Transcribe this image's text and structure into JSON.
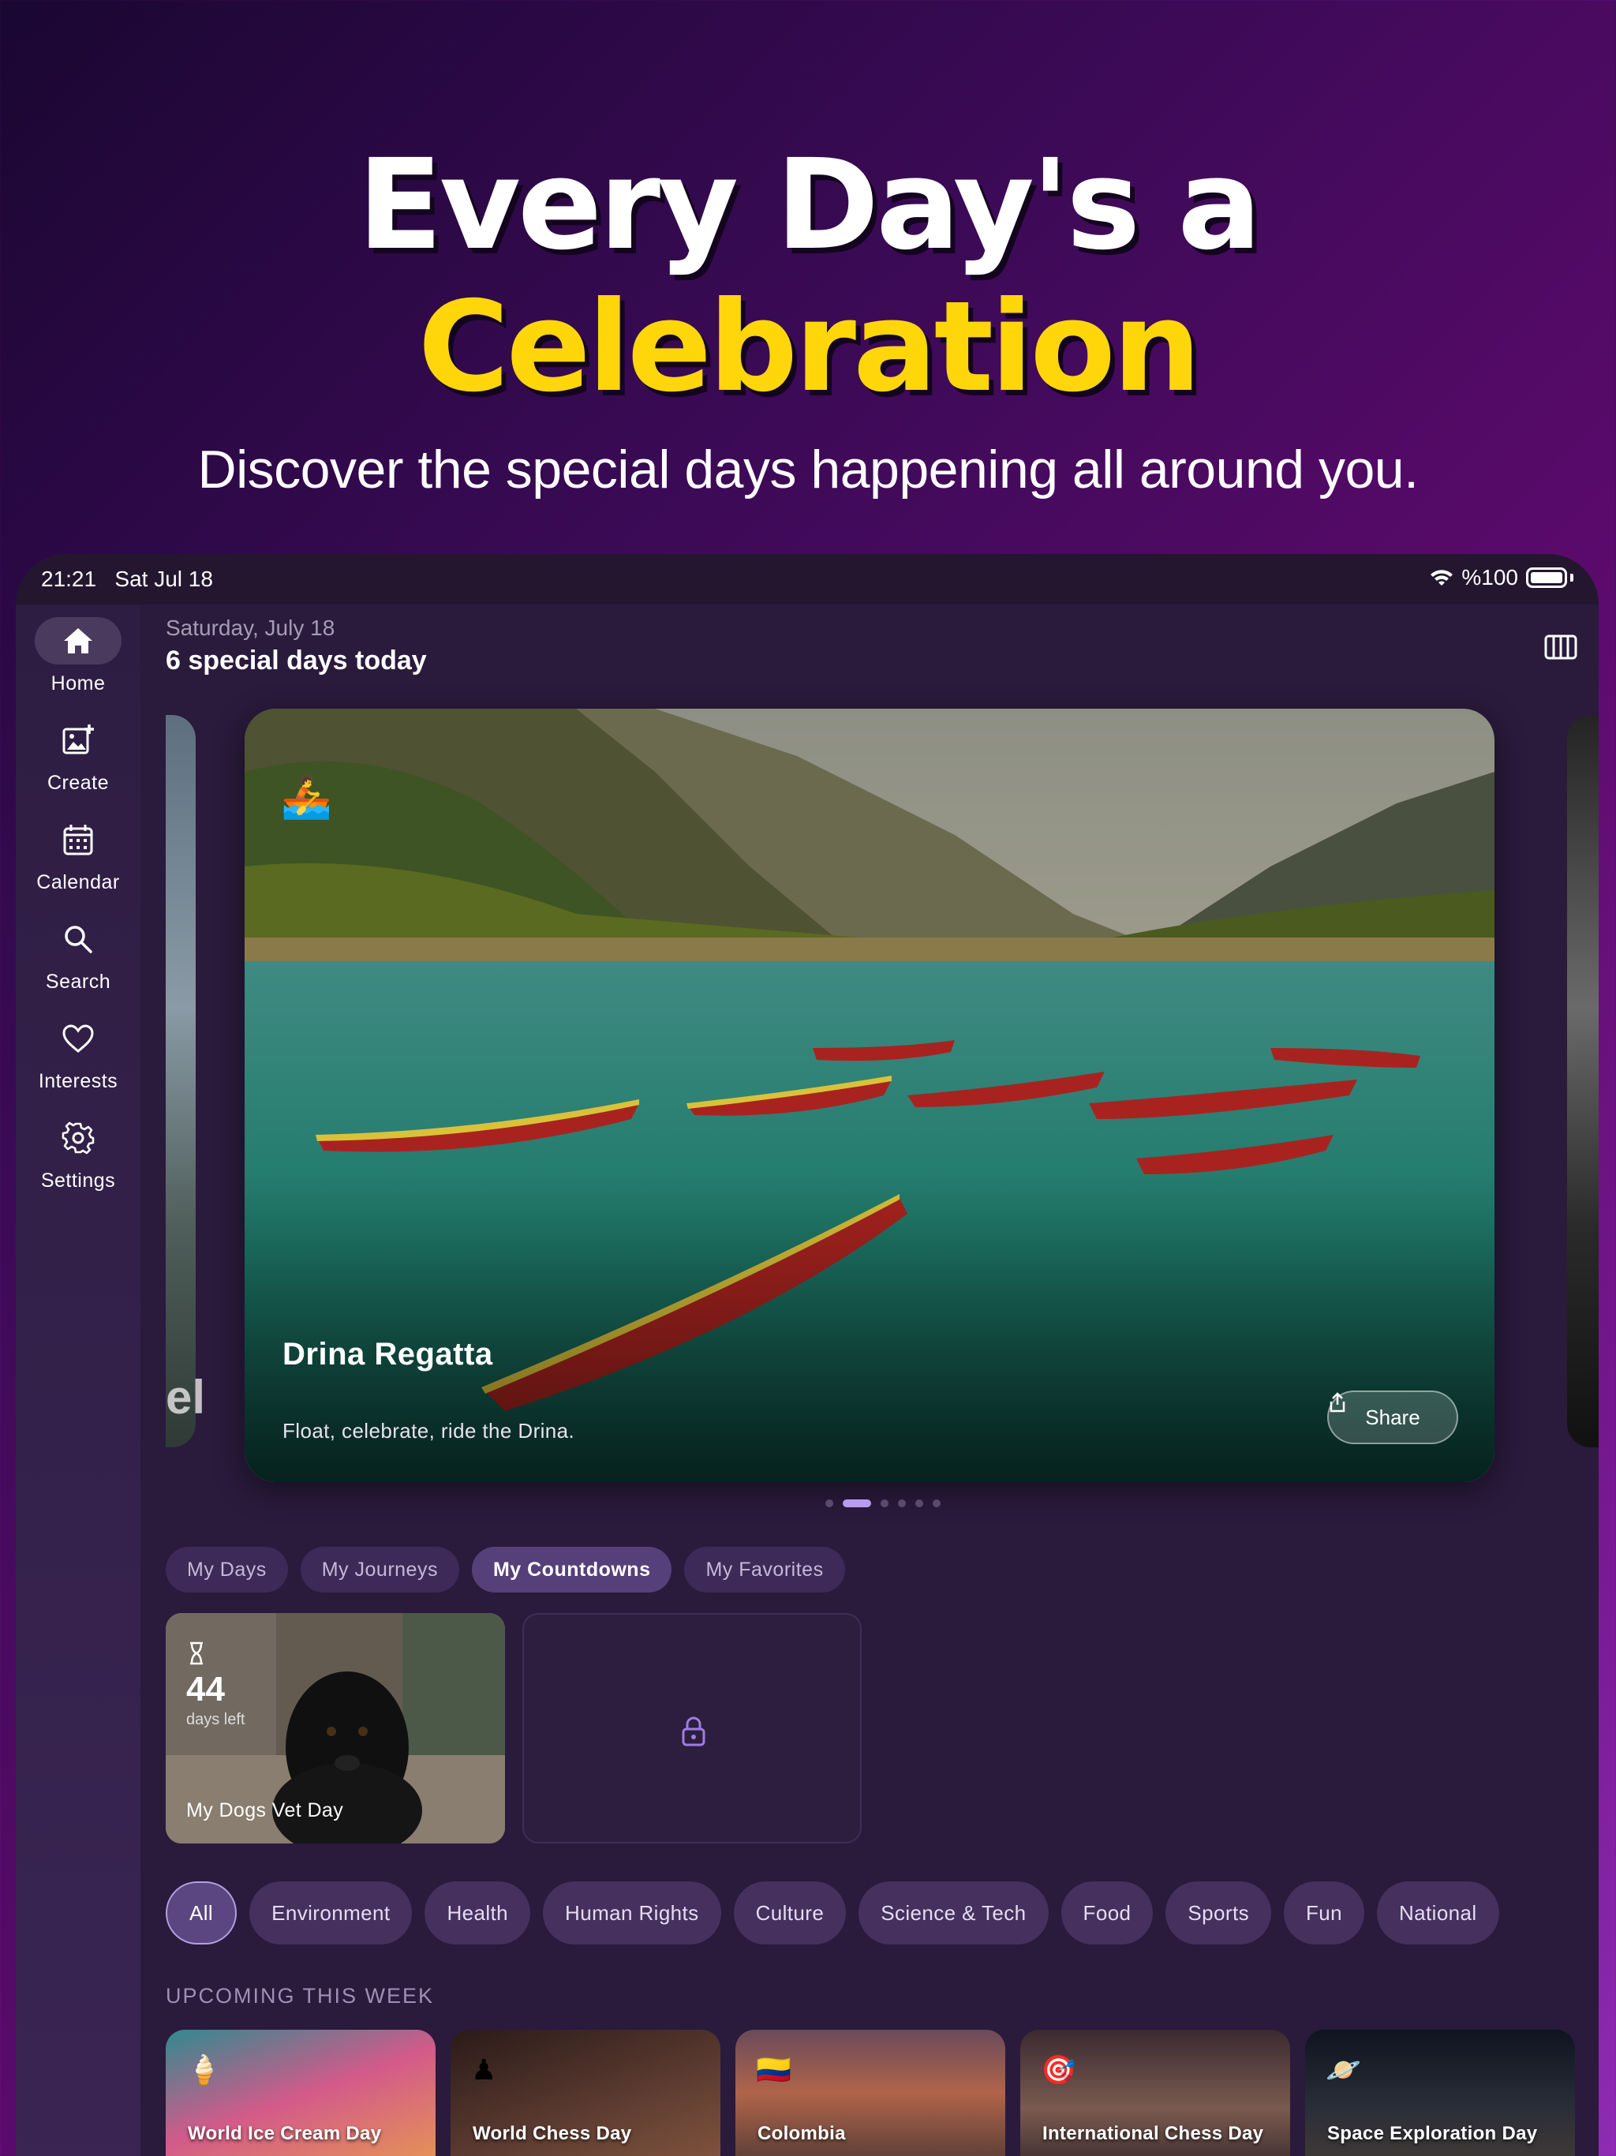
{
  "hero": {
    "line1": "Every Day's a",
    "line2": "Celebration",
    "subtitle": "Discover the special days happening all around you."
  },
  "status_bar": {
    "time": "21:21",
    "date": "Sat Jul 18",
    "battery": "%100"
  },
  "sidebar": {
    "items": [
      {
        "label": "Home",
        "icon": "home-icon",
        "active": true
      },
      {
        "label": "Create",
        "icon": "image-plus-icon"
      },
      {
        "label": "Calendar",
        "icon": "calendar-icon"
      },
      {
        "label": "Search",
        "icon": "search-icon"
      },
      {
        "label": "Interests",
        "icon": "heart-icon"
      },
      {
        "label": "Settings",
        "icon": "gear-icon"
      }
    ]
  },
  "header": {
    "date": "Saturday, July 18",
    "count": "6 special days today"
  },
  "featured": {
    "emoji": "🚣",
    "title": "Drina Regatta",
    "description": "Float, celebrate, ride the Drina.",
    "share_label": "Share",
    "page_count": 6,
    "active_page": 2,
    "peek_left_text": "el"
  },
  "collection_tabs": [
    {
      "label": "My Days"
    },
    {
      "label": "My Journeys"
    },
    {
      "label": "My Countdowns",
      "active": true
    },
    {
      "label": "My Favorites"
    }
  ],
  "countdowns": [
    {
      "icon": "hourglass-icon",
      "days": "44",
      "days_label": "days left",
      "title": "My Dogs Vet Day"
    },
    {
      "locked": true,
      "icon": "lock-icon"
    }
  ],
  "categories": [
    {
      "label": "All",
      "active": true
    },
    {
      "label": "Environment"
    },
    {
      "label": "Health"
    },
    {
      "label": "Human Rights"
    },
    {
      "label": "Culture"
    },
    {
      "label": "Science & Tech"
    },
    {
      "label": "Food"
    },
    {
      "label": "Sports"
    },
    {
      "label": "Fun"
    },
    {
      "label": "National"
    }
  ],
  "upcoming": {
    "label": "UPCOMING THIS WEEK",
    "items": [
      {
        "title": "World Ice Cream Day",
        "emoji": "🍦"
      },
      {
        "title": "World Chess Day",
        "emoji": "♟"
      },
      {
        "title": "Colombia",
        "emoji": "🇨🇴"
      },
      {
        "title": "International Chess Day",
        "emoji": "🎯"
      },
      {
        "title": "Space Exploration Day",
        "emoji": "🪐"
      }
    ]
  },
  "colors": {
    "accent_yellow": "#ffd60a",
    "surface": "#2a1a3c",
    "pill": "#45305e",
    "dot_active": "#b89cf0"
  }
}
